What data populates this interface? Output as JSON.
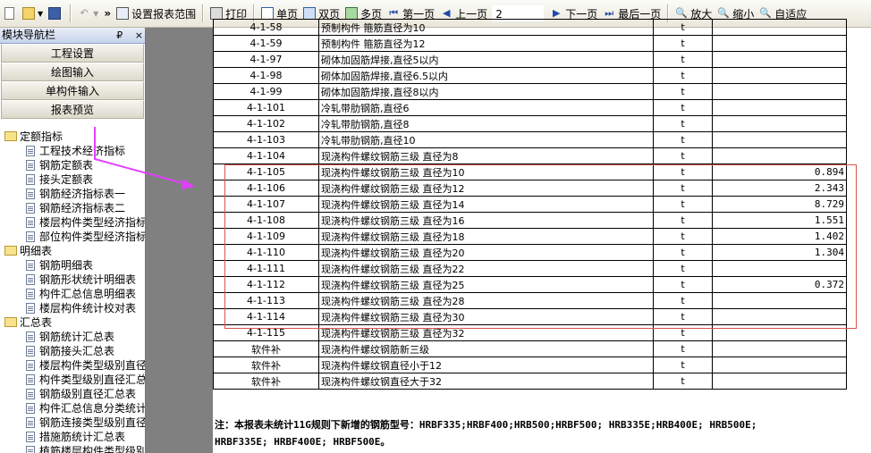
{
  "toolbar": {
    "report_range": "设置报表范围",
    "print": "打印",
    "single_page": "单页",
    "double_page": "双页",
    "multi_page": "多页",
    "first_page": "第一页",
    "prev_page": "上一页",
    "page_number": "2",
    "next_page": "下一页",
    "last_page": "最后一页",
    "zoom_in": "放大",
    "zoom_out": "缩小",
    "fit": "自适应"
  },
  "sidebar": {
    "title": "模块导航栏",
    "pin": "₽",
    "close": "×",
    "buttons": [
      "工程设置",
      "绘图输入",
      "单构件输入",
      "报表预览"
    ],
    "groups": [
      {
        "label": "定额指标",
        "items": [
          "工程技术经济指标",
          "钢筋定额表",
          "接头定额表",
          "钢筋经济指标表一",
          "钢筋经济指标表二",
          "楼层构件类型经济指标",
          "部位构件类型经济指标"
        ]
      },
      {
        "label": "明细表",
        "items": [
          "钢筋明细表",
          "钢筋形状统计明细表",
          "构件汇总信息明细表",
          "楼层构件统计校对表"
        ]
      },
      {
        "label": "汇总表",
        "items": [
          "钢筋统计汇总表",
          "钢筋接头汇总表",
          "楼层构件类型级别直径",
          "构件类型级别直径汇总",
          "钢筋级别直径汇总表",
          "构件汇总信息分类统计",
          "钢筋连接类型级别直径",
          "措施筋统计汇总表",
          "植筋楼层构件类型级别"
        ]
      }
    ]
  },
  "report": {
    "rows": [
      {
        "code": "4-1-58",
        "name": "预制构件 箍筋直径为10",
        "unit": "t",
        "value": ""
      },
      {
        "code": "4-1-59",
        "name": "预制构件 箍筋直径为12",
        "unit": "t",
        "value": ""
      },
      {
        "code": "4-1-97",
        "name": "砌体加固筋焊接,直径5以内",
        "unit": "t",
        "value": ""
      },
      {
        "code": "4-1-98",
        "name": "砌体加固筋焊接,直径6.5以内",
        "unit": "t",
        "value": ""
      },
      {
        "code": "4-1-99",
        "name": "砌体加固筋焊接,直径8以内",
        "unit": "t",
        "value": ""
      },
      {
        "code": "4-1-101",
        "name": "冷轧带肋钢筋,直径6",
        "unit": "t",
        "value": ""
      },
      {
        "code": "4-1-102",
        "name": "冷轧带肋钢筋,直径8",
        "unit": "t",
        "value": ""
      },
      {
        "code": "4-1-103",
        "name": "冷轧带肋钢筋,直径10",
        "unit": "t",
        "value": ""
      },
      {
        "code": "4-1-104",
        "name": "现浇构件螺纹钢筋三级 直径为8",
        "unit": "t",
        "value": ""
      },
      {
        "code": "4-1-105",
        "name": "现浇构件螺纹钢筋三级 直径为10",
        "unit": "t",
        "value": "0.894"
      },
      {
        "code": "4-1-106",
        "name": "现浇构件螺纹钢筋三级 直径为12",
        "unit": "t",
        "value": "2.343"
      },
      {
        "code": "4-1-107",
        "name": "现浇构件螺纹钢筋三级 直径为14",
        "unit": "t",
        "value": "8.729"
      },
      {
        "code": "4-1-108",
        "name": "现浇构件螺纹钢筋三级 直径为16",
        "unit": "t",
        "value": "1.551"
      },
      {
        "code": "4-1-109",
        "name": "现浇构件螺纹钢筋三级 直径为18",
        "unit": "t",
        "value": "1.402"
      },
      {
        "code": "4-1-110",
        "name": "现浇构件螺纹钢筋三级 直径为20",
        "unit": "t",
        "value": "1.304"
      },
      {
        "code": "4-1-111",
        "name": "现浇构件螺纹钢筋三级 直径为22",
        "unit": "t",
        "value": ""
      },
      {
        "code": "4-1-112",
        "name": "现浇构件螺纹钢筋三级 直径为25",
        "unit": "t",
        "value": "0.372"
      },
      {
        "code": "4-1-113",
        "name": "现浇构件螺纹钢筋三级 直径为28",
        "unit": "t",
        "value": ""
      },
      {
        "code": "4-1-114",
        "name": "现浇构件螺纹钢筋三级 直径为30",
        "unit": "t",
        "value": ""
      },
      {
        "code": "4-1-115",
        "name": "现浇构件螺纹钢筋三级 直径为32",
        "unit": "t",
        "value": ""
      },
      {
        "code": "软件补",
        "name": "现浇构件螺纹钢筋新三级",
        "unit": "t",
        "value": ""
      },
      {
        "code": "软件补",
        "name": "现浇构件螺纹钢直径小于12",
        "unit": "t",
        "value": ""
      },
      {
        "code": "软件补",
        "name": "现浇构件螺纹钢直径大于32",
        "unit": "t",
        "value": ""
      }
    ],
    "note_line1": "注：本报表未统计11G规则下新增的钢筋型号：HRBF335;HRBF400;HRB500;HRBF500; HRB335E;HRB400E; HRB500E;",
    "note_line2": "HRBF335E; HRBF400E; HRBF500E。"
  },
  "colors": {
    "annotation_arrow": "#e040fb",
    "highlight_box": "#d9534f"
  }
}
